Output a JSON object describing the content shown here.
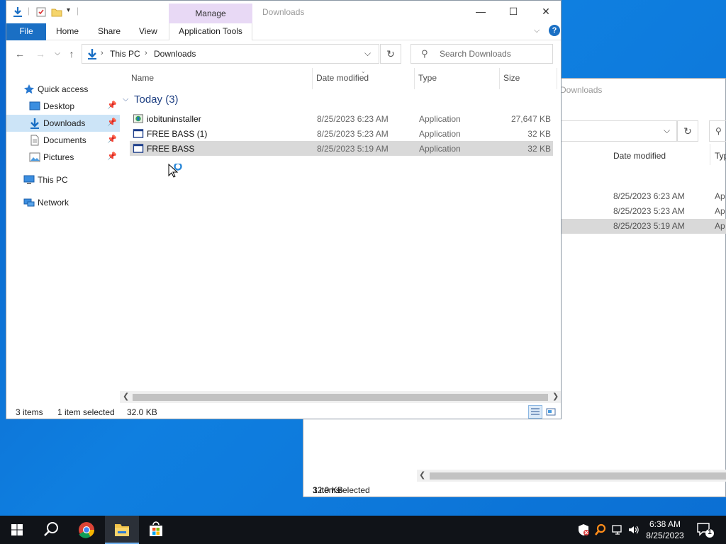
{
  "window": {
    "title": "Downloads",
    "contextual_tab": "Manage",
    "minimize": "—",
    "maximize": "☐",
    "close": "✕"
  },
  "ribbon": {
    "tabs": [
      "File",
      "Home",
      "Share",
      "View",
      "Application Tools"
    ]
  },
  "address": {
    "crumbs": [
      "This PC",
      "Downloads"
    ],
    "search_placeholder": "Search Downloads"
  },
  "sidebar": {
    "items": [
      {
        "label": "Quick access"
      },
      {
        "label": "Desktop"
      },
      {
        "label": "Downloads"
      },
      {
        "label": "Documents"
      },
      {
        "label": "Pictures"
      },
      {
        "label": "This PC"
      },
      {
        "label": "Network"
      }
    ]
  },
  "columns": {
    "name": "Name",
    "date": "Date modified",
    "type": "Type",
    "size": "Size"
  },
  "group": {
    "label": "Today (3)"
  },
  "files": [
    {
      "name": "iobituninstaller",
      "date": "8/25/2023 6:23 AM",
      "type": "Application",
      "size": "27,647 KB"
    },
    {
      "name": "FREE BASS (1)",
      "date": "8/25/2023 5:23 AM",
      "type": "Application",
      "size": "32 KB"
    },
    {
      "name": "FREE BASS",
      "date": "8/25/2023 5:19 AM",
      "type": "Application",
      "size": "32 KB"
    }
  ],
  "status": {
    "count": "3 items",
    "selected": "1 item selected",
    "size": "32.0 KB"
  },
  "bg_window": {
    "title_fragment": "Downloads",
    "date_header": "Date modified",
    "type_header_fragment": "Typ",
    "dates": [
      "8/25/2023 6:23 AM",
      "8/25/2023 5:23 AM",
      "8/25/2023 5:19 AM"
    ],
    "type_fragment": "Ap",
    "status": {
      "count": "3 items",
      "selected": "1 item selected",
      "size": "32.0 KB"
    }
  },
  "taskbar": {
    "time": "6:38 AM",
    "date": "8/25/2023",
    "notification_count": "1"
  },
  "colors": {
    "accent": "#1a6fc4",
    "manage_tab": "#e8d9f5",
    "selection": "#cce4f7",
    "row_selected": "#d9d9d9"
  }
}
